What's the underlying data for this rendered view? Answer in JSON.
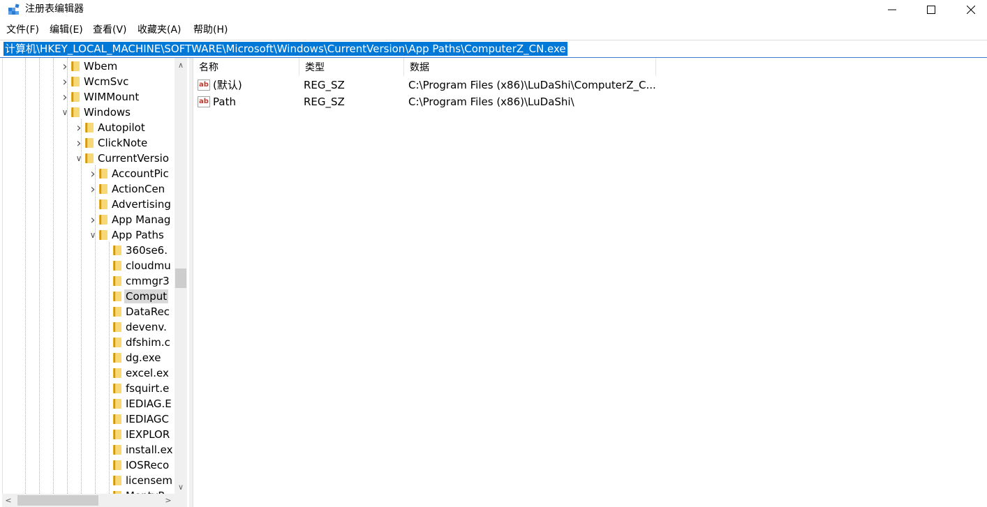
{
  "window": {
    "title": "注册表编辑器",
    "icon": "registry-editor-icon"
  },
  "menu": [
    {
      "label": "文件(F)"
    },
    {
      "label": "编辑(E)"
    },
    {
      "label": "查看(V)"
    },
    {
      "label": "收藏夹(A)"
    },
    {
      "label": "帮助(H)"
    }
  ],
  "address": {
    "path": "计算机\\HKEY_LOCAL_MACHINE\\SOFTWARE\\Microsoft\\Windows\\CurrentVersion\\App Paths\\ComputerZ_CN.exe"
  },
  "tree": {
    "items": [
      {
        "label": "Wbem",
        "expander": "collapsed"
      },
      {
        "label": "WcmSvc",
        "expander": "collapsed"
      },
      {
        "label": "WIMMount",
        "expander": "collapsed"
      },
      {
        "label": "Windows",
        "expander": "expanded"
      },
      {
        "label": "Autopilot",
        "expander": "collapsed"
      },
      {
        "label": "ClickNote",
        "expander": "collapsed"
      },
      {
        "label": "CurrentVersio",
        "expander": "expanded"
      },
      {
        "label": "AccountPic",
        "expander": "collapsed"
      },
      {
        "label": "ActionCen",
        "expander": "collapsed"
      },
      {
        "label": "Advertising",
        "expander": "none"
      },
      {
        "label": "App Manag",
        "expander": "collapsed"
      },
      {
        "label": "App Paths",
        "expander": "expanded"
      },
      {
        "label": "360se6.",
        "expander": "none"
      },
      {
        "label": "cloudmu",
        "expander": "none"
      },
      {
        "label": "cmmgr3",
        "expander": "none"
      },
      {
        "label": "Comput",
        "expander": "none",
        "selected": true
      },
      {
        "label": "DataRec",
        "expander": "none"
      },
      {
        "label": "devenv.",
        "expander": "none"
      },
      {
        "label": "dfshim.c",
        "expander": "none"
      },
      {
        "label": "dg.exe",
        "expander": "none"
      },
      {
        "label": "excel.ex",
        "expander": "none"
      },
      {
        "label": "fsquirt.e",
        "expander": "none"
      },
      {
        "label": "IEDIAG.E",
        "expander": "none"
      },
      {
        "label": "IEDIAGC",
        "expander": "none"
      },
      {
        "label": "IEXPLOR",
        "expander": "none"
      },
      {
        "label": "install.ex",
        "expander": "none"
      },
      {
        "label": "IOSReco",
        "expander": "none"
      },
      {
        "label": "licensem",
        "expander": "none"
      },
      {
        "label": "MontyR",
        "expander": "none"
      }
    ]
  },
  "list": {
    "columns": [
      "名称",
      "类型",
      "数据"
    ],
    "rows": [
      {
        "name": "(默认)",
        "type": "REG_SZ",
        "data": "C:\\Program Files (x86)\\LuDaShi\\ComputerZ_C..."
      },
      {
        "name": "Path",
        "type": "REG_SZ",
        "data": "C:\\Program Files (x86)\\LuDaShi\\"
      }
    ]
  },
  "colors": {
    "selection": "#0078d7",
    "tree_selected": "#d9d9d9",
    "folder": "#f8d775"
  }
}
